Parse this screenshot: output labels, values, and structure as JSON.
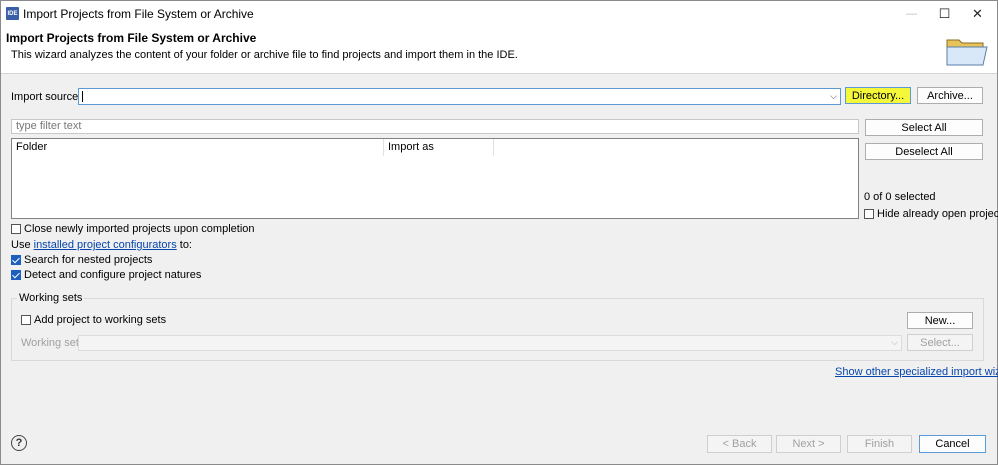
{
  "window": {
    "app_icon_text": "IDE",
    "title": "Import Projects from File System or Archive",
    "controls": {
      "minimize": "—",
      "maximize": "☐",
      "close": "✕"
    }
  },
  "header": {
    "title": "Import Projects from File System or Archive",
    "description": "This wizard analyzes the content of your folder or archive file to find projects and import them in the IDE."
  },
  "import_source": {
    "label": "Import source:",
    "value": "",
    "directory_button": "Directory...",
    "archive_button": "Archive..."
  },
  "filter": {
    "placeholder": "type filter text"
  },
  "table": {
    "columns": [
      "Folder",
      "Import as"
    ]
  },
  "side_buttons": {
    "select_all": "Select All",
    "deselect_all": "Deselect All",
    "selection_count": "0 of 0 selected",
    "hide_open_label": "Hide already open projects"
  },
  "options": {
    "close_after_label": "Close newly imported projects upon completion",
    "use_prefix": "Use ",
    "configurators_link": "installed project configurators",
    "use_suffix": " to:",
    "search_nested_label": "Search for nested projects",
    "detect_natures_label": "Detect and configure project natures"
  },
  "working_sets": {
    "group_label": "Working sets",
    "add_label": "Add project to working sets",
    "new_button": "New...",
    "sets_label": "Working sets:",
    "select_button": "Select..."
  },
  "other_wizards_link": "Show other specialized import wizards",
  "footer": {
    "help": "?",
    "back": "< Back",
    "next": "Next >",
    "finish": "Finish",
    "cancel": "Cancel"
  }
}
